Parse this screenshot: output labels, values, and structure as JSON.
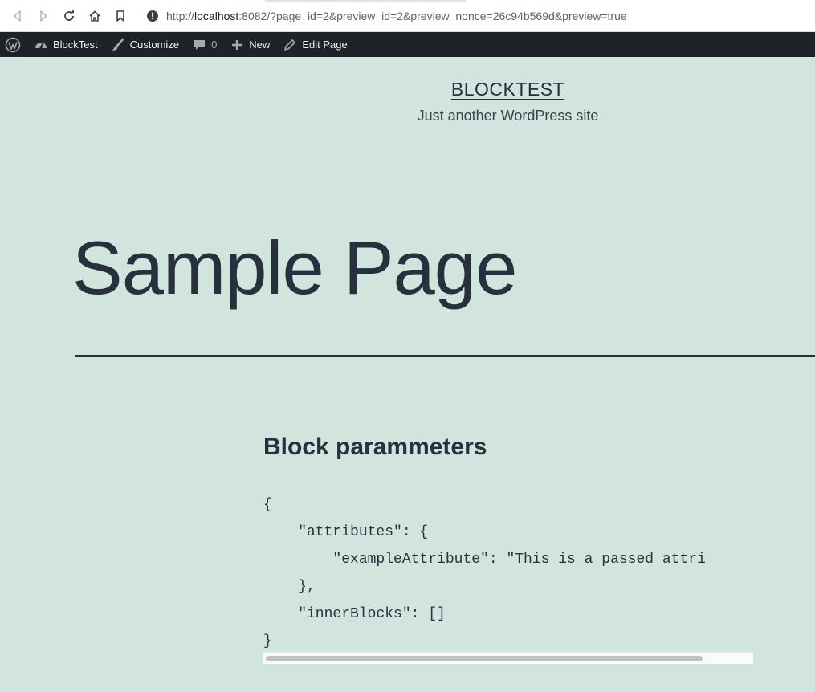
{
  "browser": {
    "url_prefix": "http://",
    "url_host": "localhost",
    "url_rest": ":8082/?page_id=2&preview_id=2&preview_nonce=26c94b569d&preview=true",
    "icons": [
      "back-icon",
      "forward-icon",
      "reload-icon",
      "home-icon",
      "bookmark-icon",
      "info-icon"
    ]
  },
  "admin_bar": {
    "site_name": "BlockTest",
    "customize": "Customize",
    "comments_count": "0",
    "new": "New",
    "edit_page": "Edit Page"
  },
  "site": {
    "title": "BLOCKTEST",
    "description": "Just another WordPress site"
  },
  "page": {
    "title": "Sample Page"
  },
  "block": {
    "heading": "Block parammeters",
    "code_lines": [
      "{",
      "    \"attributes\": {",
      "        \"exampleAttribute\": \"This is a passed attri",
      "    },",
      "    \"innerBlocks\": []",
      "}"
    ],
    "scroll_fraction": 0.9
  },
  "colors": {
    "background": "#d1e4dd",
    "text": "#28303d",
    "admin_bar": "#1d2327"
  }
}
